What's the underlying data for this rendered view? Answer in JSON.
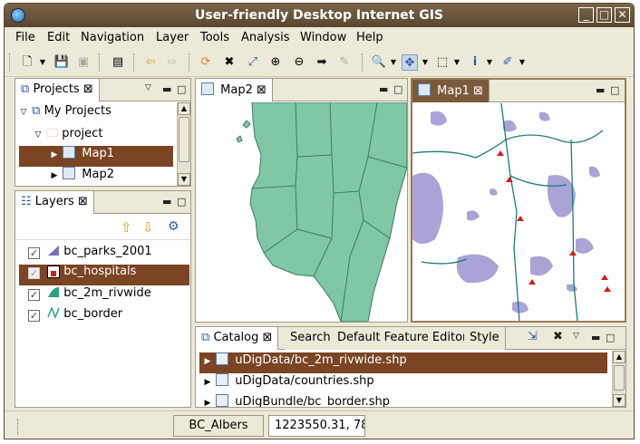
{
  "window": {
    "title": "User-friendly Desktop Internet GIS"
  },
  "menu": [
    "File",
    "Edit",
    "Navigation",
    "Layer",
    "Tools",
    "Analysis",
    "Window",
    "Help"
  ],
  "projects_panel": {
    "tab_label": "Projects",
    "tree": [
      {
        "label": "My Projects",
        "level": 0,
        "expanded": true,
        "selected": false
      },
      {
        "label": "project",
        "level": 1,
        "expanded": true,
        "selected": false
      },
      {
        "label": "Map1",
        "level": 2,
        "expanded": false,
        "selected": true
      },
      {
        "label": "Map2",
        "level": 2,
        "expanded": false,
        "selected": false
      }
    ]
  },
  "layers_panel": {
    "tab_label": "Layers",
    "layers": [
      {
        "label": "bc_parks_2001",
        "checked": true,
        "selected": false,
        "icon": "polygon-layer-icon"
      },
      {
        "label": "bc_hospitals",
        "checked": true,
        "selected": true,
        "icon": "point-layer-icon"
      },
      {
        "label": "bc_2m_rivwide",
        "checked": true,
        "selected": false,
        "icon": "polygon-layer-icon"
      },
      {
        "label": "bc_border",
        "checked": true,
        "selected": false,
        "icon": "line-layer-icon"
      }
    ]
  },
  "map2": {
    "tab_label": "Map2"
  },
  "map1": {
    "tab_label": "Map1"
  },
  "catalog_panel": {
    "tabs": [
      "Catalog",
      "Search",
      "Default Feature Editor",
      "Style"
    ],
    "items": [
      {
        "label": "uDigData/bc_2m_rivwide.shp",
        "selected": true
      },
      {
        "label": "uDigData/countries.shp",
        "selected": false
      },
      {
        "label": "uDigBundle/bc_border.shp",
        "selected": false
      }
    ]
  },
  "status": {
    "crs": "BC_Albers",
    "coordinates": "1223550.31, 78"
  },
  "colors": {
    "accent": "#7b4423",
    "land": "#7fc7a5",
    "water": "#aaa4d6",
    "river": "#1f7a7a",
    "hospital": "#d21c1c"
  }
}
